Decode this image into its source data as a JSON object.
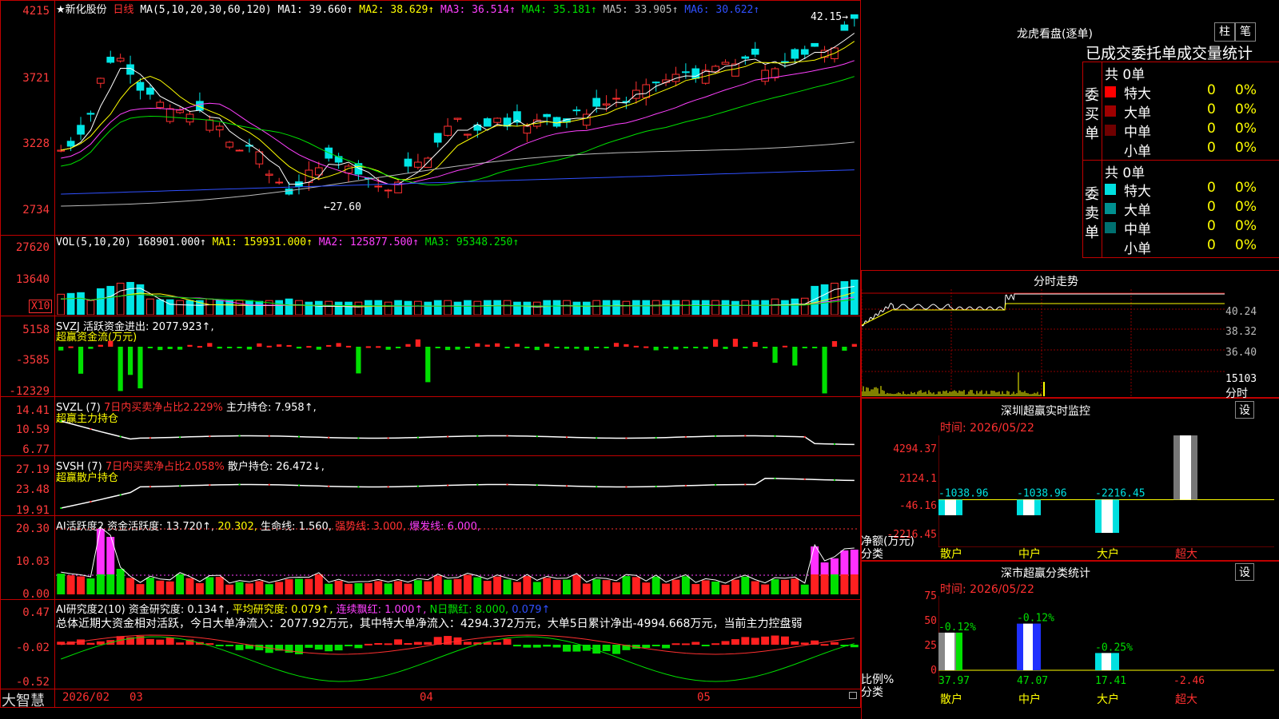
{
  "main": {
    "stock_name": "★新化股份",
    "period": "日线",
    "ma_header": "MA(5,10,20,30,60,120)",
    "ma": [
      {
        "label": "MA1: 39.660↑",
        "color": "#ffffff"
      },
      {
        "label": "MA2: 38.629↑",
        "color": "#ffff00"
      },
      {
        "label": "MA3: 36.514↑",
        "color": "#ff40ff"
      },
      {
        "label": "MA4: 35.181↑",
        "color": "#00e000"
      },
      {
        "label": "MA5: 33.905↑",
        "color": "#bbbbbb"
      },
      {
        "label": "MA6: 30.622↑",
        "color": "#3050ff"
      }
    ],
    "y_ticks": [
      "4215",
      "3721",
      "3228",
      "2734"
    ],
    "high_label": "42.15",
    "low_label": "27.60"
  },
  "vol": {
    "header": "VOL(5,10,20)",
    "vol_value": "168901.000↑",
    "ma1": "MA1: 159931.000↑",
    "ma2": "MA2: 125877.500↑",
    "ma3": "MA3: 95348.250↑",
    "y_ticks": [
      "27620",
      "13640"
    ],
    "unit": "X10",
    "bars": [
      26,
      27,
      28,
      18,
      33,
      36,
      40,
      41,
      38,
      20,
      19,
      19,
      18,
      18,
      18,
      20,
      18,
      18,
      18,
      18,
      17,
      18,
      18,
      20,
      18,
      16,
      17,
      17,
      16,
      16,
      16,
      18,
      18,
      16,
      18,
      17,
      17,
      16,
      18,
      18,
      16,
      18,
      17,
      18,
      18,
      18,
      16,
      16,
      16,
      18,
      18,
      18,
      16,
      16,
      18,
      18,
      18,
      17,
      18,
      18,
      18,
      18,
      18,
      18,
      18,
      18,
      18,
      18,
      17,
      18,
      18,
      18,
      20,
      18,
      20,
      21,
      36,
      38,
      40,
      42,
      44
    ]
  },
  "svzj": {
    "header": "SVZJ  活跃资金进出: 2077.923↑,",
    "subtitle": "超赢资金流(万元)",
    "y_ticks": [
      "5158",
      "-3585",
      "-12329"
    ]
  },
  "svzl": {
    "header1": "SVZL (7)",
    "header2": "7日内买卖净占比2.229%",
    "header3": "主力持仓: 7.958↑,",
    "subtitle": "超赢主力持仓",
    "y_ticks": [
      "14.41",
      "10.59",
      "6.77"
    ]
  },
  "svsh": {
    "header1": "SVSH (7)",
    "header2": "7日内买卖净占比2.058%",
    "header3": "散户持仓: 26.472↓,",
    "subtitle": "超赢散户持仓",
    "y_ticks": [
      "27.19",
      "23.48",
      "19.91"
    ]
  },
  "ai_active": {
    "header1": "AI活跃度2",
    "header2": "资金活跃度: 13.720↑,",
    "header3": "20.302,",
    "header4": "生命线: 1.560,",
    "header5": "强势线: 3.000,",
    "header6": "爆发线: 6.000,",
    "y_ticks": [
      "20.30",
      "10.03",
      "0.00"
    ]
  },
  "ai_research": {
    "header1": "AI研究度2(10)",
    "header2": "资金研究度: 0.134↑,",
    "header3": "平均研究度: 0.079↑,",
    "header4": "连续飘红: 1.000↑,",
    "header5": "N日飘红: 8.000,",
    "header6": "0.079↑",
    "summary": "总体近期大资金相对活跃，今日大单净流入：2077.92万元，其中特大单净流入：4294.372万元，大单5日累计净出-4994.668万元，当前主力控盘弱",
    "y_ticks": [
      "0.47",
      "-0.02",
      "-0.52"
    ]
  },
  "footer": {
    "app_name": "大智慧",
    "dates": [
      "2026/02",
      "03",
      "04",
      "05"
    ]
  },
  "dragon_tiger": {
    "title": "龙虎看盘(逐单)",
    "btn_bar": "柱",
    "btn_pen": "笔",
    "header": "已成交委托单成交量统计",
    "buy_label": "委买单",
    "sell_label": "委卖单",
    "buy_total": "共 0单",
    "sell_total": "共 0单",
    "buy_rows": [
      {
        "label": "特大",
        "count": "0",
        "pct": "0%",
        "color": "#ff0000"
      },
      {
        "label": "大单",
        "count": "0",
        "pct": "0%",
        "color": "#a00000"
      },
      {
        "label": "中单",
        "count": "0",
        "pct": "0%",
        "color": "#700000"
      },
      {
        "label": "小单",
        "count": "0",
        "pct": "0%",
        "color": "#000000"
      }
    ],
    "sell_rows": [
      {
        "label": "特大",
        "count": "0",
        "pct": "0%",
        "color": "#00e0e0"
      },
      {
        "label": "大单",
        "count": "0",
        "pct": "0%",
        "color": "#009090"
      },
      {
        "label": "中单",
        "count": "0",
        "pct": "0%",
        "color": "#007070"
      },
      {
        "label": "小单",
        "count": "0",
        "pct": "0%",
        "color": "#000000"
      }
    ]
  },
  "intraday": {
    "title": "分时走势",
    "y_ticks": [
      "40.24",
      "38.32",
      "36.40"
    ],
    "vol_tick": "15103",
    "unit": "分时"
  },
  "sz_monitor": {
    "title": "深圳超赢实时监控",
    "btn": "设",
    "date": "时间: 2026/05/22",
    "y_ticks": [
      "4294.37",
      "2124.1",
      "-46.16",
      "-2216.45"
    ],
    "ylabel1": "净额(万元)",
    "ylabel2": "分类",
    "categories": [
      "散户",
      "中户",
      "大户",
      "超大"
    ],
    "values": [
      "-1038.96",
      "-1038.96",
      "-2216.45",
      "4294.37"
    ]
  },
  "sz_class": {
    "title": "深市超赢分类统计",
    "btn": "设",
    "date": "时间: 2026/05/22",
    "y_ticks": [
      "75",
      "50",
      "25",
      "0"
    ],
    "ylabel1": "比例%",
    "ylabel2": "分类",
    "categories": [
      "散户",
      "中户",
      "大户",
      "超大"
    ],
    "top_labels": [
      "-0.12%",
      "-0.12%",
      "-0.25%",
      ""
    ],
    "values": [
      "37.97",
      "47.07",
      "17.41",
      "-2.46"
    ]
  }
}
